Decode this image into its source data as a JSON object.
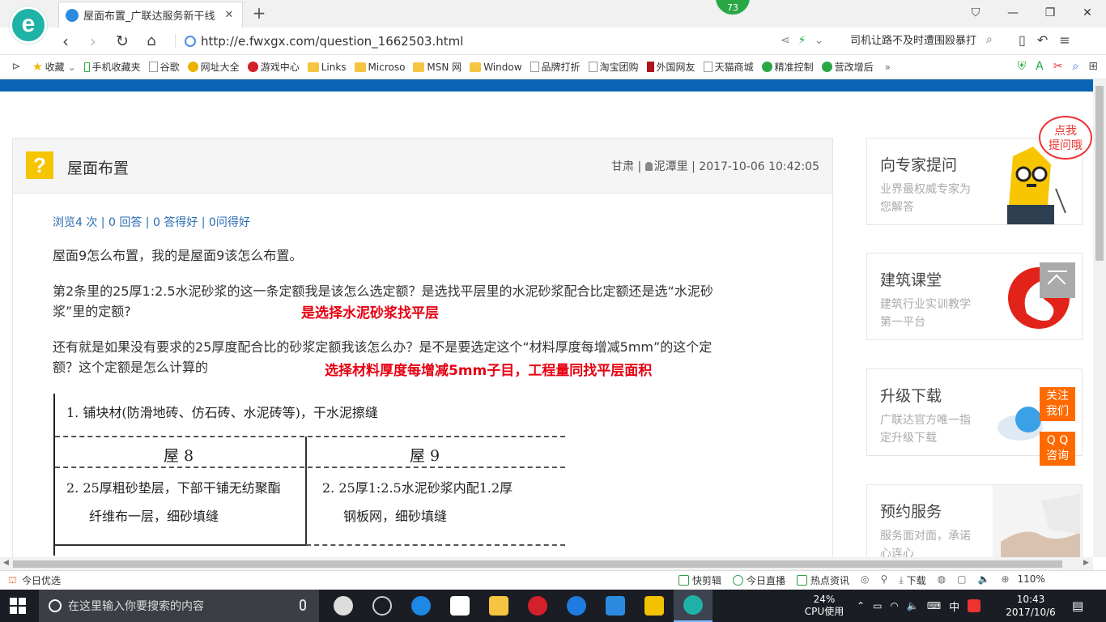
{
  "browser": {
    "tab_title": "屋面布置_广联达服务新干线",
    "badge_count": "73",
    "url": "http://e.fwxgx.com/question_1662503.html",
    "search_text": "司机让路不及时遭围殴暴打"
  },
  "bookmarks": [
    {
      "label": "收藏",
      "icon": "star-icon"
    },
    {
      "label": "手机收藏夹",
      "icon": "phone-icon"
    },
    {
      "label": "谷歌",
      "icon": "page-icon"
    },
    {
      "label": "网址大全",
      "icon": "globe-icon"
    },
    {
      "label": "游戏中心",
      "icon": "game-icon"
    },
    {
      "label": "Links",
      "icon": "folder-icon"
    },
    {
      "label": "Microso",
      "icon": "folder-icon"
    },
    {
      "label": "MSN 网",
      "icon": "folder-icon"
    },
    {
      "label": "Window",
      "icon": "folder-icon"
    },
    {
      "label": "品牌打折",
      "icon": "page-icon"
    },
    {
      "label": "淘宝团购",
      "icon": "page-icon"
    },
    {
      "label": "外国网友",
      "icon": "bookmark-icon"
    },
    {
      "label": "天猫商城",
      "icon": "page-icon"
    },
    {
      "label": "精准控制",
      "icon": "wechat-icon"
    },
    {
      "label": "营改增后",
      "icon": "wechat-icon"
    }
  ],
  "question": {
    "title": "屋面布置",
    "region": "甘肃",
    "author": "泥潭里",
    "datetime": "2017-10-06 10:42:05",
    "stats": "浏览4 次 | 0 回答 | 0 答得好 | 0问得好",
    "p1": "屋面9怎么布置，我的是屋面9该怎么布置。",
    "p2_line1": "第2条里的25厚1:2.5水泥砂浆的这一条定额我是该怎么选定额？是选找平层里的水泥砂浆配合比定额还是选“水泥砂",
    "p2_line2": "浆”里的定额?",
    "ans1": "是选择水泥砂浆找平层",
    "p3_line1": "还有就是如果没有要求的25厚度配合比的砂浆定额我该怎么办？是不是要选定这个“材料厚度每增减5mm”的这个定",
    "p3_line2": "额？这个定额是怎么计算的",
    "ans2": "选择材料厚度每增减5mm子目，工程量同找平层面积"
  },
  "scan": {
    "line1": "1. 铺块材(防滑地砖、仿石砖、水泥砖等)，干水泥擦缝",
    "col1_header": "屋 8",
    "col2_header": "屋 9",
    "col1_l1": "2. 25厚粗砂垫层，下部干铺无纺聚酯",
    "col1_l2": "纤维布一层，细砂填缝",
    "col2_l1": "2. 25厚1:2.5水泥砂浆内配1.2厚",
    "col2_l2": "钢板网，细砂填缝"
  },
  "sidebar": {
    "bubble": [
      "点我",
      "提问哦"
    ],
    "cards": [
      {
        "title": "向专家提问",
        "sub": "业界最权威专家为您解答"
      },
      {
        "title": "建筑课堂",
        "sub": "建筑行业实训教学第一平台"
      },
      {
        "title": "升级下载",
        "sub": "广联达官方唯一指定升级下载"
      },
      {
        "title": "预约服务",
        "sub": "服务面对面，承诺心连心"
      }
    ],
    "float_follow": [
      "关注",
      "我们"
    ],
    "float_qq": [
      "Q Q",
      "咨询"
    ]
  },
  "statusbar": {
    "left": "今日优选",
    "items": [
      "快剪辑",
      "今日直播",
      "热点资讯",
      "下载"
    ],
    "zoom": "110%"
  },
  "taskbar": {
    "search_placeholder": "在这里输入你要搜索的内容",
    "cpu_percent": "24%",
    "cpu_label": "CPU使用",
    "ime": "中",
    "time": "10:43",
    "date": "2017/10/6"
  },
  "colors": {
    "brand_blue": "#0a63b5",
    "answer_red": "#e60012",
    "float_orange": "#ff6a00",
    "link_blue": "#2a6db3"
  }
}
